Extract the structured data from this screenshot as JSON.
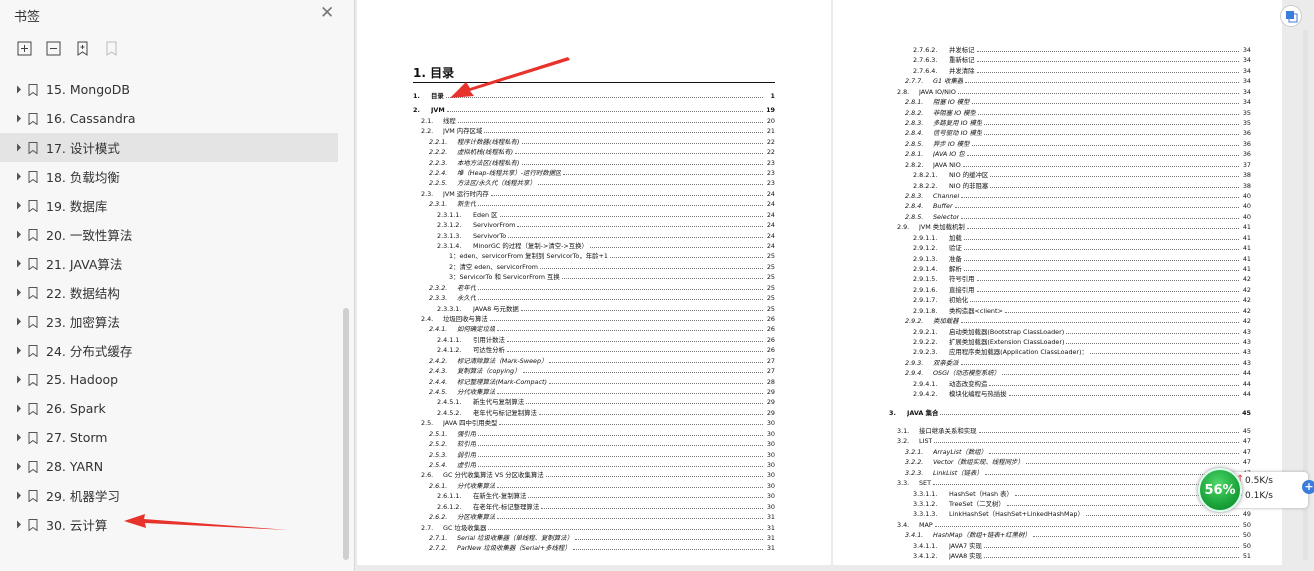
{
  "sidebar": {
    "title": "书签",
    "toolbar": [
      "expand-all",
      "collapse-all",
      "add-bookmark",
      "bookmark-disabled"
    ],
    "items": [
      {
        "label": "15. MongoDB"
      },
      {
        "label": "16. Cassandra"
      },
      {
        "label": "17. 设计模式"
      },
      {
        "label": "18. 负载均衡"
      },
      {
        "label": "19. 数据库"
      },
      {
        "label": "20. 一致性算法"
      },
      {
        "label": "21. JAVA算法"
      },
      {
        "label": "22. 数据结构"
      },
      {
        "label": "23. 加密算法"
      },
      {
        "label": "24. 分布式缓存"
      },
      {
        "label": "25. Hadoop"
      },
      {
        "label": "26. Spark"
      },
      {
        "label": "27. Storm"
      },
      {
        "label": "28. YARN"
      },
      {
        "label": "29. 机器学习"
      },
      {
        "label": "30. 云计算"
      }
    ],
    "active_index": 2
  },
  "page1": {
    "heading": "1. 目录",
    "entries": [
      [
        "1.",
        "目录",
        "1",
        "b"
      ],
      [
        "2.",
        "JVM",
        "19",
        "b"
      ],
      [
        "2.1.",
        "线程",
        "20",
        ""
      ],
      [
        "2.2.",
        "JVM 内存区域",
        "21",
        ""
      ],
      [
        "2.2.1.",
        "程序计数器(线程私有)",
        "22",
        "i"
      ],
      [
        "2.2.2.",
        "虚拟机栈(线程私有)",
        "22",
        "i"
      ],
      [
        "2.2.3.",
        "本地方法区(线程私有)",
        "23",
        "i"
      ],
      [
        "2.2.4.",
        "堆（Heap-线程共享）-运行时数据区",
        "23",
        "i"
      ],
      [
        "2.2.5.",
        "方法区/永久代（线程共享）",
        "23",
        "i"
      ],
      [
        "2.3.",
        "JVM 运行时内存",
        "24",
        ""
      ],
      [
        "2.3.1.",
        "新生代",
        "24",
        "i"
      ],
      [
        "2.3.1.1.",
        "Eden 区",
        "24",
        ""
      ],
      [
        "2.3.1.2.",
        "ServivorFrom",
        "24",
        ""
      ],
      [
        "2.3.1.3.",
        "ServivorTo",
        "24",
        ""
      ],
      [
        "2.3.1.4.",
        "MinorGC 的过程（复制->清空->互换）",
        "24",
        ""
      ],
      [
        "",
        "1：eden、servicorFrom 复制到 ServicorTo，年龄+1",
        "25",
        ""
      ],
      [
        "",
        "2：清空 eden、servicorFrom",
        "25",
        ""
      ],
      [
        "",
        "3：ServicorTo 和 ServicorFrom 互换",
        "25",
        ""
      ],
      [
        "2.3.2.",
        "老年代",
        "25",
        "i"
      ],
      [
        "2.3.3.",
        "永久代",
        "25",
        "i"
      ],
      [
        "2.3.3.1.",
        "JAVA8 与元数据",
        "25",
        ""
      ],
      [
        "2.4.",
        "垃圾回收与算法",
        "26",
        ""
      ],
      [
        "2.4.1.",
        "如何确定垃圾",
        "26",
        "i"
      ],
      [
        "2.4.1.1.",
        "引用计数法",
        "26",
        ""
      ],
      [
        "2.4.1.2.",
        "可达性分析",
        "26",
        ""
      ],
      [
        "2.4.2.",
        "标记清除算法（Mark-Sweep）",
        "27",
        "i"
      ],
      [
        "2.4.3.",
        "复制算法（copying）",
        "27",
        "i"
      ],
      [
        "2.4.4.",
        "标记整理算法(Mark-Compact)",
        "28",
        "i"
      ],
      [
        "2.4.5.",
        "分代收集算法",
        "29",
        "i"
      ],
      [
        "2.4.5.1.",
        "新生代与复制算法",
        "29",
        ""
      ],
      [
        "2.4.5.2.",
        "老年代与标记复制算法",
        "29",
        ""
      ],
      [
        "2.5.",
        "JAVA 四中引用类型",
        "30",
        ""
      ],
      [
        "2.5.1.",
        "强引用",
        "30",
        "i"
      ],
      [
        "2.5.2.",
        "软引用",
        "30",
        "i"
      ],
      [
        "2.5.3.",
        "弱引用",
        "30",
        "i"
      ],
      [
        "2.5.4.",
        "虚引用",
        "30",
        "i"
      ],
      [
        "2.6.",
        "GC 分代收集算法 VS 分区收集算法",
        "30",
        ""
      ],
      [
        "2.6.1.",
        "分代收集算法",
        "30",
        "i"
      ],
      [
        "2.6.1.1.",
        "在新生代-复制算法",
        "30",
        ""
      ],
      [
        "2.6.1.2.",
        "在老年代-标记整理算法",
        "30",
        ""
      ],
      [
        "2.6.2.",
        "分区收集算法",
        "31",
        "i"
      ],
      [
        "2.7.",
        "GC 垃圾收集器",
        "31",
        ""
      ],
      [
        "2.7.1.",
        "Serial 垃圾收集器（单线程、复制算法）",
        "31",
        "i"
      ],
      [
        "2.7.2.",
        "ParNew 垃圾收集器（Serial+多线程）",
        "31",
        "i"
      ]
    ]
  },
  "page2": {
    "entries": [
      [
        "2.7.6.2.",
        "并发标记",
        "34",
        ""
      ],
      [
        "2.7.6.3.",
        "重新标记",
        "34",
        ""
      ],
      [
        "2.7.6.4.",
        "并发清除",
        "34",
        ""
      ],
      [
        "2.7.7.",
        "G1 收集器",
        "34",
        "i"
      ],
      [
        "2.8.",
        "JAVA IO/NIO",
        "34",
        ""
      ],
      [
        "2.8.1.",
        "阻塞 IO 模型",
        "34",
        "i"
      ],
      [
        "2.8.2.",
        "非阻塞 IO 模型",
        "35",
        "i"
      ],
      [
        "2.8.3.",
        "多路复用 IO 模型",
        "35",
        "i"
      ],
      [
        "2.8.4.",
        "信号驱动 IO 模型",
        "36",
        "i"
      ],
      [
        "2.8.5.",
        "异步 IO 模型",
        "36",
        "i"
      ],
      [
        "2.8.1.",
        "JAVA IO 包",
        "36",
        "i"
      ],
      [
        "2.8.2.",
        "JAVA NIO",
        "37",
        ""
      ],
      [
        "2.8.2.1.",
        "NIO 的缓冲区",
        "38",
        ""
      ],
      [
        "2.8.2.2.",
        "NIO 的非阻塞",
        "38",
        ""
      ],
      [
        "2.8.3.",
        "Channel",
        "40",
        "i"
      ],
      [
        "2.8.4.",
        "Buffer",
        "40",
        "i"
      ],
      [
        "2.8.5.",
        "Selector",
        "40",
        "i"
      ],
      [
        "2.9.",
        "JVM 类加载机制",
        "41",
        ""
      ],
      [
        "2.9.1.1.",
        "加载",
        "41",
        ""
      ],
      [
        "2.9.1.2.",
        "验证",
        "41",
        ""
      ],
      [
        "2.9.1.3.",
        "准备",
        "41",
        ""
      ],
      [
        "2.9.1.4.",
        "解析",
        "41",
        ""
      ],
      [
        "2.9.1.5.",
        "符号引用",
        "42",
        ""
      ],
      [
        "2.9.1.6.",
        "直接引用",
        "42",
        ""
      ],
      [
        "2.9.1.7.",
        "初始化",
        "42",
        ""
      ],
      [
        "2.9.1.8.",
        "类构造器<client>",
        "42",
        ""
      ],
      [
        "2.9.2.",
        "类加载器",
        "42",
        "i"
      ],
      [
        "2.9.2.1.",
        "启动类加载器(Bootstrap ClassLoader)",
        "43",
        ""
      ],
      [
        "2.9.2.2.",
        "扩展类加载器(Extension ClassLoader)",
        "43",
        ""
      ],
      [
        "2.9.2.3.",
        "应用程序类加载器(Application ClassLoader)：",
        "43",
        ""
      ],
      [
        "2.9.3.",
        "双亲委派",
        "43",
        "i"
      ],
      [
        "2.9.4.",
        "OSGI（动态模型系统）",
        "44",
        "i"
      ],
      [
        "2.9.4.1.",
        "动态改变构造",
        "44",
        ""
      ],
      [
        "2.9.4.2.",
        "模块化编程与热插拔",
        "44",
        ""
      ],
      [
        "3.",
        "JAVA 集合",
        "45",
        "b"
      ],
      [
        "3.1.",
        "接口继承关系和实现",
        "45",
        ""
      ],
      [
        "3.2.",
        "LIST",
        "47",
        ""
      ],
      [
        "3.2.1.",
        "ArrayList（数组）",
        "47",
        "i"
      ],
      [
        "3.2.2.",
        "Vector（数组实现、线程同步）",
        "47",
        "i"
      ],
      [
        "3.2.3.",
        "LinkList（链表）",
        "47",
        "i"
      ],
      [
        "3.3.",
        "SET",
        "48",
        ""
      ],
      [
        "3.3.1.1.",
        "HashSet（Hash 表）",
        "48",
        ""
      ],
      [
        "3.3.1.2.",
        "TreeSet（二叉树）",
        "49",
        ""
      ],
      [
        "3.3.1.3.",
        "LinkHashSet（HashSet+LinkedHashMap）",
        "49",
        ""
      ],
      [
        "3.4.",
        "MAP",
        "50",
        ""
      ],
      [
        "3.4.1.",
        "HashMap（数组+链表+红黑树）",
        "50",
        "i"
      ],
      [
        "3.4.1.1.",
        "JAVA7 实现",
        "50",
        ""
      ],
      [
        "3.4.1.2.",
        "JAVA8 实现",
        "51",
        ""
      ]
    ]
  },
  "net_widget": {
    "percent": "56%",
    "upload": "0.5K/s",
    "download": "0.1K/s"
  },
  "colors": {
    "arrow": "#e8322c",
    "gauge": "#1aa43a"
  }
}
